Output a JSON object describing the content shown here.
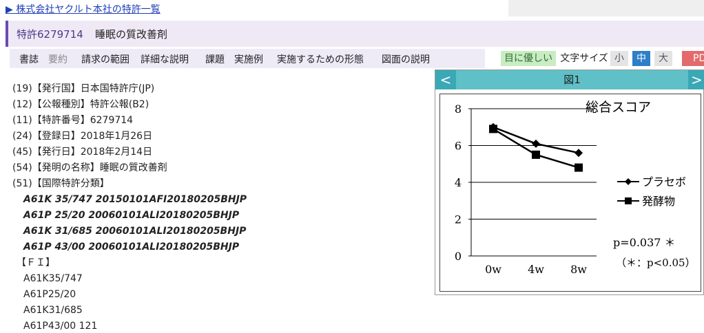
{
  "top_link": "▶ 株式会社ヤクルト本社の特許一覧",
  "title": {
    "number": "特許6279714",
    "name": "睡眠の質改善剤"
  },
  "nav": [
    "書誌",
    "要約",
    "請求の範囲",
    "詳細な説明",
    "課題",
    "実施例",
    "実施するための形態",
    "図面の説明"
  ],
  "controls": {
    "eye": "目に優しい",
    "font_size": "文字サイズ",
    "small": "小",
    "medium": "中",
    "large": "大",
    "pdf": "PD"
  },
  "meta": [
    "(19)【発行国】日本国特許庁(JP)",
    "(12)【公報種別】特許公報(B2)",
    "(11)【特許番号】6279714",
    "(24)【登録日】2018年1月26日",
    "(45)【発行日】2018年2月14日",
    "(54)【発明の名称】睡眠の質改善剤",
    "(51)【国際特許分類】"
  ],
  "ipc": [
    "A61K 35/747 20150101AFI20180205BHJP",
    "A61P 25/20 20060101ALI20180205BHJP",
    "A61K 31/685 20060101ALI20180205BHJP",
    "A61P 43/00 20060101ALI20180205BHJP"
  ],
  "fi_heading": "【ＦＩ】",
  "fi": [
    "A61K35/747",
    "A61P25/20",
    "A61K31/685",
    "A61P43/00 121"
  ],
  "figure": {
    "prev": "<",
    "next": ">",
    "title": "図1",
    "chart_data": {
      "type": "line",
      "title": "総合スコア",
      "categories": [
        "0w",
        "4w",
        "8w"
      ],
      "ylim": [
        0,
        8
      ],
      "yticks": [
        0,
        2,
        4,
        6,
        8
      ],
      "grid": true,
      "legend": "right",
      "series": [
        {
          "name": "プラセボ",
          "marker": "diamond",
          "values": [
            7.0,
            6.1,
            5.6
          ]
        },
        {
          "name": "発酵物",
          "marker": "square",
          "values": [
            6.9,
            5.5,
            4.8
          ]
        }
      ],
      "annotations": [
        "p=0.037 ＊",
        "（＊：p<0.05）"
      ]
    }
  }
}
